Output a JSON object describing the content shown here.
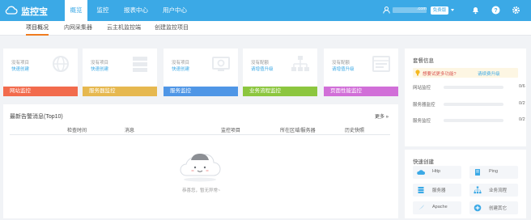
{
  "header": {
    "brand": "监控宝",
    "nav": [
      {
        "label": "概览",
        "active": true
      },
      {
        "label": "监控",
        "active": false
      },
      {
        "label": "报表中心",
        "active": false
      },
      {
        "label": "用户中心",
        "active": false
      }
    ],
    "user_suffix": ".com",
    "plan_badge": "免费版",
    "icons": [
      "user-icon",
      "bell-icon",
      "help-icon",
      "settings-icon"
    ]
  },
  "subnav": {
    "tabs": [
      {
        "label": "项目概况",
        "active": true
      },
      {
        "label": "内网采集器",
        "active": false
      },
      {
        "label": "云主机监控端",
        "active": false
      },
      {
        "label": "创建监控项目",
        "active": false
      }
    ]
  },
  "cards": [
    {
      "line1": "没有项目",
      "line2": "快速创建",
      "strip": "网站监控",
      "color": "#f26b4d",
      "icon": "website-monitor-icon"
    },
    {
      "line1": "没有项目",
      "line2": "快速创建",
      "strip": "服务器监控",
      "color": "#e6b84f",
      "icon": "server-monitor-icon"
    },
    {
      "line1": "没有项目",
      "line2": "快速创建",
      "strip": "服务监控",
      "color": "#4f96e6",
      "icon": "service-monitor-icon"
    },
    {
      "line1": "没有配额",
      "line2": "请增值升级",
      "strip": "业务流程监控",
      "color": "#8cc63f",
      "icon": "process-monitor-icon"
    },
    {
      "line1": "没有配额",
      "line2": "请增值升级",
      "strip": "页面性能监控",
      "color": "#d16fd8",
      "icon": "page-performance-icon"
    }
  ],
  "alerts": {
    "title": "最新告警消息(Top10)",
    "more": "更多 »",
    "columns": [
      "检查时间",
      "消息",
      "监控项目",
      "所在区域/服务器",
      "历史快照"
    ],
    "empty_text": "恭喜您，暂无异常~"
  },
  "plan": {
    "title": "套餐信息",
    "upgrade_prompt": "想要试更多功能?",
    "upgrade_link": "请续费升级",
    "quotas": [
      {
        "label": "网站监控",
        "used": 0,
        "total": 6,
        "count": "0/6"
      },
      {
        "label": "服务器监控",
        "used": 0,
        "total": 2,
        "count": "0/2"
      },
      {
        "label": "服务监控",
        "used": 0,
        "total": 2,
        "count": "0/2"
      }
    ]
  },
  "quick_create": {
    "title": "快速创建",
    "items": [
      {
        "label": "Http",
        "icon": "http-icon",
        "color": "#3ba9e6"
      },
      {
        "label": "Ping",
        "icon": "ping-icon",
        "color": "#3ba9e6"
      },
      {
        "label": "服务器",
        "icon": "server-icon",
        "color": "#3ba9e6"
      },
      {
        "label": "业务流程",
        "icon": "process-icon",
        "color": "#3ba9e6"
      },
      {
        "label": "Apache",
        "icon": "apache-icon",
        "color": "#3ba9e6"
      },
      {
        "label": "创建其它",
        "icon": "add-icon",
        "color": "#3ba9e6"
      }
    ]
  }
}
